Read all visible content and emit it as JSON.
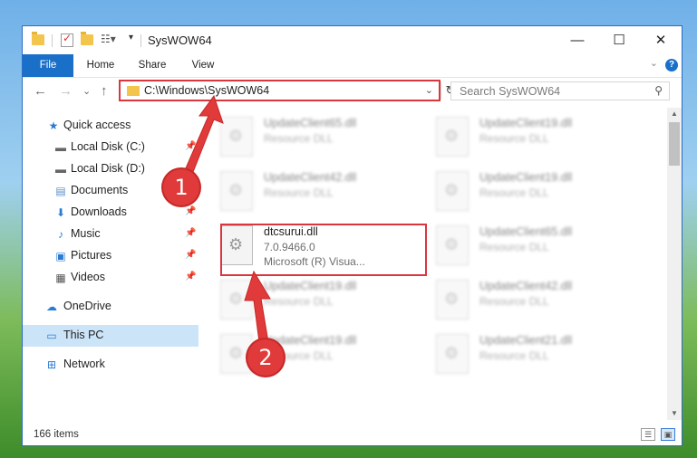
{
  "window": {
    "title": "SysWOW64",
    "min": "—",
    "max": "☐",
    "close": "✕"
  },
  "ribbon": {
    "tabs": [
      "File",
      "Home",
      "Share",
      "View"
    ],
    "help": "?"
  },
  "nav": {
    "back": "←",
    "forward": "→",
    "recent": "⌄",
    "up": "↑",
    "address": "C:\\Windows\\SysWOW64",
    "refresh": "↻",
    "search_placeholder": "Search SysWOW64"
  },
  "sidebar": {
    "items": [
      {
        "label": "Quick access",
        "icon": "star-icon"
      },
      {
        "label": "Local Disk (C:)",
        "icon": "drive-icon"
      },
      {
        "label": "Local Disk (D:)",
        "icon": "drive-icon"
      },
      {
        "label": "Documents",
        "icon": "documents-icon"
      },
      {
        "label": "Downloads",
        "icon": "downloads-icon"
      },
      {
        "label": "Music",
        "icon": "music-icon"
      },
      {
        "label": "Pictures",
        "icon": "pictures-icon"
      },
      {
        "label": "Videos",
        "icon": "videos-icon"
      },
      {
        "label": "OneDrive",
        "icon": "cloud-icon"
      },
      {
        "label": "This PC",
        "icon": "computer-icon"
      },
      {
        "label": "Network",
        "icon": "network-icon"
      }
    ]
  },
  "files": [
    {
      "name": "UpdateClient65.dll",
      "desc": "Resource DLL"
    },
    {
      "name": "UpdateClient19.dll",
      "desc": "Resource DLL"
    },
    {
      "name": "UpdateClient42.dll",
      "desc": "Resource DLL"
    },
    {
      "name": "UpdateClient19.dll",
      "desc": "Resource DLL"
    },
    {
      "name": "dtcsurui.dll",
      "version": "7.0.9466.0",
      "desc": "Microsoft (R) Visua..."
    },
    {
      "name": "UpdateClient65.dll",
      "desc": "Resource DLL"
    },
    {
      "name": "UpdateClient19.dll",
      "desc": "Resource DLL"
    },
    {
      "name": "UpdateClient42.dll",
      "desc": "Resource DLL"
    },
    {
      "name": "UpdateClient19.dll",
      "desc": "Resource DLL"
    },
    {
      "name": "UpdateClient21.dll",
      "desc": "Resource DLL"
    }
  ],
  "status": {
    "count": "166 items"
  },
  "callouts": [
    "1",
    "2"
  ],
  "colors": {
    "accent": "#1a6fc9",
    "highlight": "#d9363e",
    "callout": "#e03a3a",
    "selected": "#cce4f7"
  }
}
